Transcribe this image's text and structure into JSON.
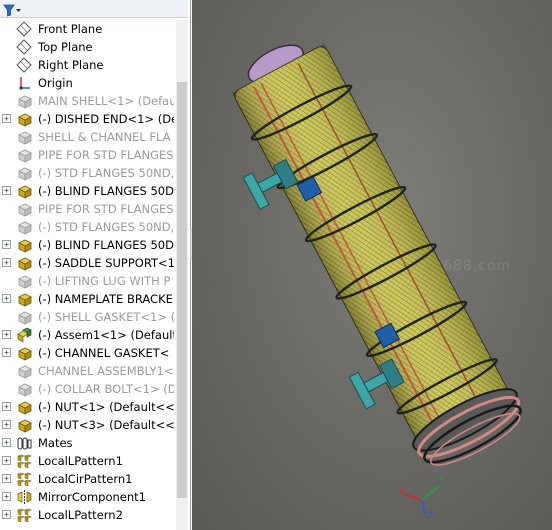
{
  "feature_tree": {
    "items": [
      {
        "label": "Front Plane",
        "icon": "plane-icon",
        "suppressed": false,
        "expandable": false
      },
      {
        "label": "Top Plane",
        "icon": "plane-icon",
        "suppressed": false,
        "expandable": false
      },
      {
        "label": "Right Plane",
        "icon": "plane-icon",
        "suppressed": false,
        "expandable": false
      },
      {
        "label": "Origin",
        "icon": "origin-icon",
        "suppressed": false,
        "expandable": false
      },
      {
        "label": "MAIN SHELL<1> (Defau",
        "icon": "part-icon",
        "suppressed": true,
        "expandable": false
      },
      {
        "label": "(-) DISHED END<1> (De",
        "icon": "part-icon",
        "suppressed": false,
        "expandable": true
      },
      {
        "label": "SHELL & CHANNEL FLA",
        "icon": "part-icon",
        "suppressed": true,
        "expandable": false
      },
      {
        "label": "PIPE FOR STD FLANGES",
        "icon": "part-icon",
        "suppressed": true,
        "expandable": false
      },
      {
        "label": "(-) STD FLANGES 50ND,",
        "icon": "part-icon",
        "suppressed": true,
        "expandable": false
      },
      {
        "label": "(-) BLIND FLANGES 50D",
        "icon": "part-icon",
        "suppressed": false,
        "expandable": true
      },
      {
        "label": "PIPE FOR STD FLANGES",
        "icon": "part-icon",
        "suppressed": true,
        "expandable": false
      },
      {
        "label": "(-) STD FLANGES 50ND,",
        "icon": "part-icon",
        "suppressed": true,
        "expandable": false
      },
      {
        "label": "(-) BLIND FLANGES 50D",
        "icon": "part-icon",
        "suppressed": false,
        "expandable": true
      },
      {
        "label": "(-) SADDLE SUPPORT<1",
        "icon": "part-icon",
        "suppressed": false,
        "expandable": true
      },
      {
        "label": "(-) LIFTING LUG WITH P",
        "icon": "part-icon",
        "suppressed": true,
        "expandable": false
      },
      {
        "label": "(-) NAMEPLATE BRACKE",
        "icon": "part-icon",
        "suppressed": false,
        "expandable": true
      },
      {
        "label": "(-) SHELL GASKET<1> (",
        "icon": "part-icon",
        "suppressed": true,
        "expandable": false
      },
      {
        "label": "(-) Assem1<1> (Default",
        "icon": "assembly-icon",
        "suppressed": false,
        "expandable": true
      },
      {
        "label": "(-) CHANNEL GASKET<",
        "icon": "part-icon",
        "suppressed": false,
        "expandable": true
      },
      {
        "label": "CHANNEL ASSEMBLY1<",
        "icon": "part-icon",
        "suppressed": true,
        "expandable": false
      },
      {
        "label": "(-) COLLAR BOLT<1> (D",
        "icon": "part-icon",
        "suppressed": true,
        "expandable": false
      },
      {
        "label": "(-) NUT<1> (Default<<l",
        "icon": "part-icon",
        "suppressed": false,
        "expandable": true
      },
      {
        "label": "(-) NUT<3> (Default<<l",
        "icon": "part-icon",
        "suppressed": false,
        "expandable": true
      },
      {
        "label": "Mates",
        "icon": "mates-icon",
        "suppressed": false,
        "expandable": true
      },
      {
        "label": "LocalLPattern1",
        "icon": "pattern-icon",
        "suppressed": false,
        "expandable": true
      },
      {
        "label": "LocalCirPattern1",
        "icon": "pattern-icon",
        "suppressed": false,
        "expandable": true
      },
      {
        "label": "MirrorComponent1",
        "icon": "mirror-icon",
        "suppressed": false,
        "expandable": true
      },
      {
        "label": "LocalLPattern2",
        "icon": "pattern-icon",
        "suppressed": false,
        "expandable": true
      }
    ]
  },
  "viewport": {
    "watermark": "cad2688.com",
    "triad": {
      "x_label": "X",
      "y_label": "Y",
      "z_label": "Z"
    }
  },
  "colors": {
    "shell": "#cfc64a",
    "shell_mesh": "#3e4a3a",
    "dished_end": "#b79ac8",
    "flange_rim": "#d48886",
    "saddle": "#3fa6a8",
    "nameplate": "#1f5fa8",
    "tie_rod": "#c0563a"
  }
}
